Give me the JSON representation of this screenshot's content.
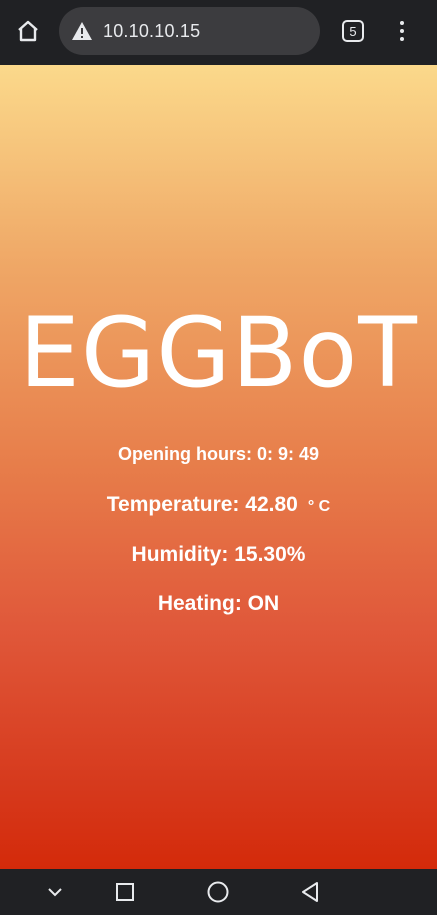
{
  "browser": {
    "url": "10.10.10.15",
    "tab_count": "5",
    "home_icon": "home-icon",
    "security_icon": "warning-triangle-icon",
    "menu_icon": "more-vertical-icon"
  },
  "page": {
    "title": "EGGBoT",
    "opening_hours": "Opening hours: 0: 9: 49",
    "temperature": "Temperature: 42.80",
    "temperature_unit": "° C",
    "humidity": "Humidity: 15.30%",
    "heating": "Heating: ON"
  },
  "nav": {
    "icons": [
      "chevron-down-icon",
      "square-icon",
      "circle-icon",
      "back-triangle-icon"
    ]
  },
  "colors": {
    "gradient_top": "#fbd98b",
    "gradient_bottom": "#d42a0a",
    "chrome": "#202124"
  }
}
